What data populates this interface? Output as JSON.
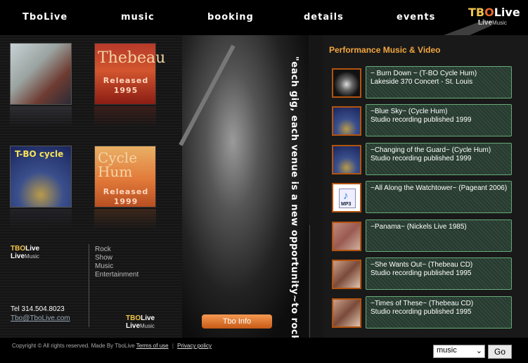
{
  "nav": {
    "items": [
      {
        "label": "TboLive"
      },
      {
        "label": "music"
      },
      {
        "label": "booking"
      },
      {
        "label": "details"
      },
      {
        "label": "events"
      }
    ]
  },
  "logo": {
    "t": "T",
    "b": "B",
    "o": "O",
    "live": "Live",
    "small_live": "Live",
    "small_music": "Music"
  },
  "albums": [
    {
      "script": "",
      "released": ""
    },
    {
      "script": "Thebeau",
      "released": "Released\n1995"
    },
    {
      "script": "T-BO cycle",
      "released": ""
    },
    {
      "script": "Cycle Hum",
      "released": "Released\n1999"
    }
  ],
  "sidebar": {
    "brand1": {
      "tbo": "TBO",
      "live": "Live",
      "line2_live": "Live",
      "line2_music": "Music"
    },
    "tags": [
      "Rock",
      "Show",
      "Music",
      "Entertainment"
    ],
    "tel": "Tel  314.504.8023",
    "email": "Tbo@TboLive.com",
    "brand2": {
      "tbo": "TBO",
      "live": "Live",
      "line2_live": "Live",
      "line2_music": "Music"
    }
  },
  "quote": "\"each gig, each venue is a new opportunity~to rock \"",
  "info_button": "Tbo Info",
  "playlist": {
    "title": "Performance Music & Video",
    "tracks": [
      {
        "title": "~ Burn Down ~ (T-BO Cycle Hum)",
        "sub": "  Lakeside 370 Concert - St. Louis",
        "thumb": "t1"
      },
      {
        "title": "~Blue Sky~ (Cycle Hum)",
        "sub": "Studio recording published 1999",
        "thumb": "t2"
      },
      {
        "title": "~Changing of the Guard~ (Cycle Hum)",
        "sub": "Studio recording published 1999",
        "thumb": "t2"
      },
      {
        "title": "~All Along the Watchtower~ (Pageant 2006)",
        "sub": "",
        "thumb": "t3",
        "mp3": "MP3"
      },
      {
        "title": "~Panama~ (Nickels Live 1985)",
        "sub": "",
        "thumb": "t4"
      },
      {
        "title": "~She Wants Out~  (Thebeau CD)",
        "sub": "Studio recording published 1995",
        "thumb": "t5"
      },
      {
        "title": "~Times of These~ (Thebeau CD)",
        "sub": "Studio recording published 1995",
        "thumb": "t5"
      }
    ]
  },
  "footer": {
    "copyright": "Copyright © All rights reserved. Made By TboLive",
    "terms": "Terms of use",
    "privacy": "Privacy policy",
    "select_value": "music",
    "go_label": "Go"
  }
}
